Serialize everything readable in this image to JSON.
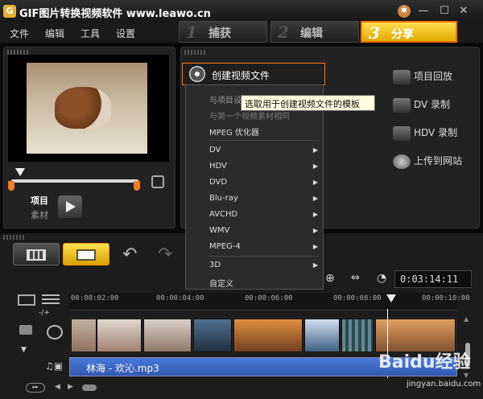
{
  "app": {
    "title": "GIF图片转换视频软件 www.leawo.cn",
    "icon": "app-logo-icon"
  },
  "window_buttons": [
    "help-icon",
    "minimize-icon",
    "maximize-icon",
    "close-icon"
  ],
  "menu": [
    "文件",
    "编辑",
    "工具",
    "设置"
  ],
  "steps": [
    {
      "num": "1",
      "label": "捕获"
    },
    {
      "num": "2",
      "label": "编辑"
    },
    {
      "num": "3",
      "label": "分享"
    }
  ],
  "preview": {
    "mode_project": "项目",
    "mode_clip": "素材",
    "play_icon": "play-icon",
    "position": 0.07
  },
  "share": {
    "create_label": "创建视频文件",
    "tooltip": "选取用于创建视频文件的模板",
    "actions": [
      {
        "label": "项目回放",
        "icon": "playback-icon"
      },
      {
        "label": "DV 录制",
        "icon": "dv-camera-icon"
      },
      {
        "label": "HDV 录制",
        "icon": "hdv-camera-icon"
      },
      {
        "label": "上传到网站",
        "icon": "globe-icon"
      }
    ]
  },
  "dropdown": {
    "items": [
      {
        "label": "与项目设",
        "submenu": false,
        "disabled": true
      },
      {
        "label": "与第一个视频素材相同",
        "submenu": false,
        "disabled": true
      },
      {
        "label": "MPEG 优化器",
        "submenu": false
      },
      {
        "label": "DV",
        "submenu": true
      },
      {
        "label": "HDV",
        "submenu": true
      },
      {
        "label": "DVD",
        "submenu": true
      },
      {
        "label": "Blu-ray",
        "submenu": true
      },
      {
        "label": "AVCHD",
        "submenu": true
      },
      {
        "label": "WMV",
        "submenu": true
      },
      {
        "label": "MPEG-4",
        "submenu": true
      },
      {
        "label": "3D",
        "submenu": true
      },
      {
        "label": "自定义",
        "submenu": false
      }
    ]
  },
  "timeline": {
    "timecode": "0:03:14:11",
    "ruler": [
      "00:00:02:00",
      "00:00:04:00",
      "00:00:06:00",
      "00:00:08:00",
      "00:00:10:00"
    ],
    "audio_clip": "林海 - 欢沁.mp3",
    "zoom_label": "-/+"
  },
  "watermark": {
    "brand": "Baidu经验",
    "url": "jingyan.baidu.com"
  }
}
